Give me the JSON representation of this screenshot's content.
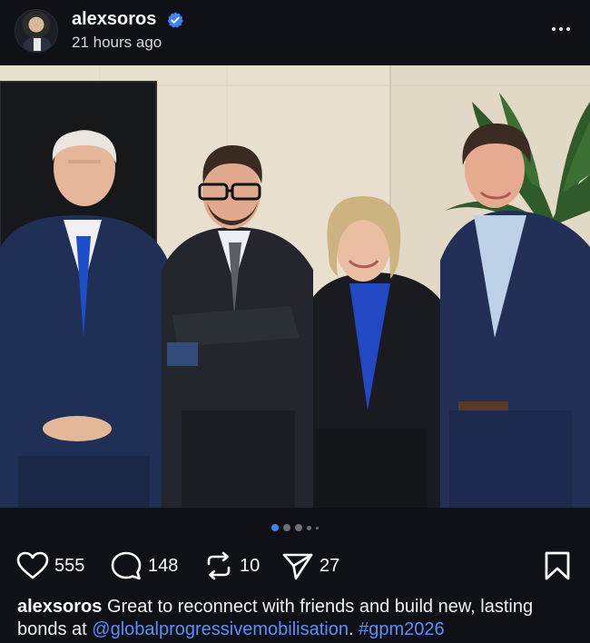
{
  "post": {
    "author": {
      "username": "alexsoros",
      "verified": true,
      "avatar_icon": "avatar-photo"
    },
    "timestamp": "21 hours ago",
    "menu_icon": "more-horizontal-icon",
    "carousel": {
      "total": 5,
      "active_index": 0
    },
    "actions": {
      "likes": "555",
      "comments": "148",
      "reposts": "10",
      "shares": "27"
    },
    "caption": {
      "username": "alexsoros",
      "text": " Great to reconnect with friends and build new, lasting bonds at ",
      "mention": "@globalprogressivemobilisation",
      "separator": ". ",
      "hashtag": "#gpm2026"
    }
  },
  "colors": {
    "background": "#0f1117",
    "link": "#5b8ff9",
    "verified": "#3d82f6",
    "active_dot": "#3d82f6"
  }
}
